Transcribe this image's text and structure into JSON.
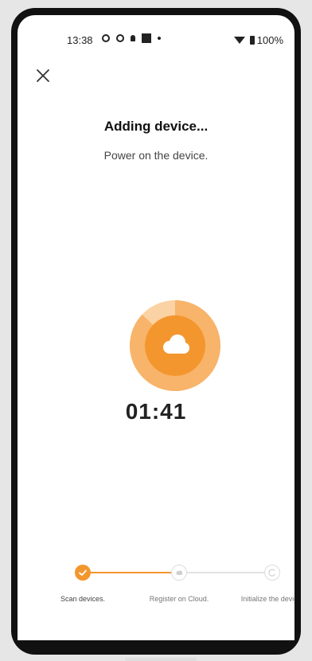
{
  "status_bar": {
    "time": "13:38",
    "battery": "100%"
  },
  "header": {
    "title": "Adding device...",
    "subtitle": "Power on the device."
  },
  "timer": "01:41",
  "progress": {
    "value": 0.87
  },
  "steps": [
    {
      "label": "Scan devices.",
      "state": "done"
    },
    {
      "label": "Register on Cloud.",
      "state": "pending"
    },
    {
      "label": "Initialize the device.",
      "state": "pending"
    }
  ],
  "colors": {
    "accent": "#f4962e",
    "accent_light": "#fbd2a3",
    "accent_mid": "#f8b46a",
    "inactive": "#d7d7d7"
  },
  "icons": {
    "close": "close-icon",
    "center": "cloud-icon",
    "step_done": "check-icon",
    "step_register": "cloud-icon",
    "step_init": "cycle-icon"
  }
}
